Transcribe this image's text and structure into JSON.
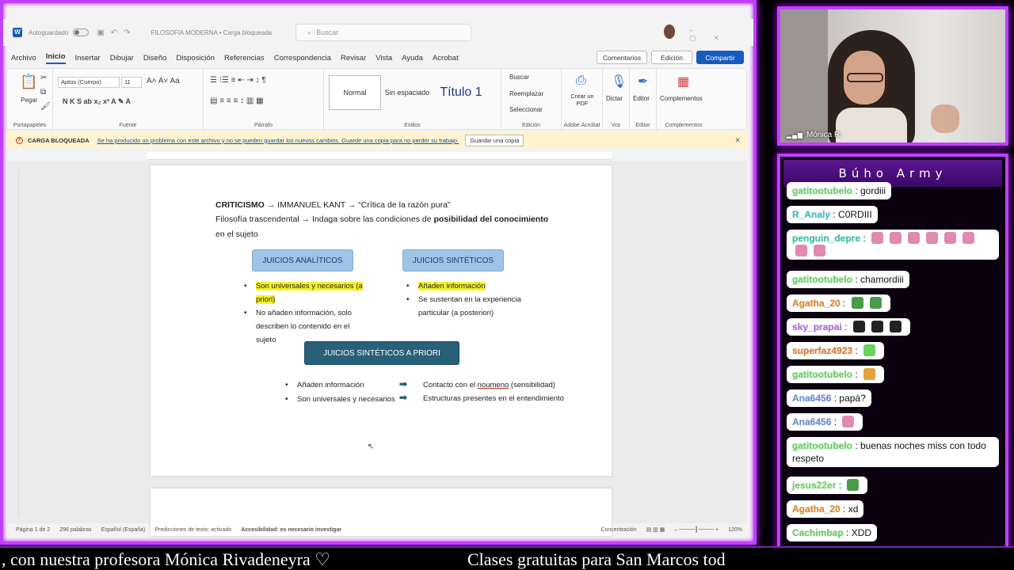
{
  "word": {
    "autosave_label": "Autoguardado",
    "doc_title": "FILOSOFIA MODERNA • Carga bloqueada",
    "search_placeholder": "Buscar",
    "menu": [
      "Archivo",
      "Inicio",
      "Insertar",
      "Dibujar",
      "Diseño",
      "Disposición",
      "Referencias",
      "Correspondencia",
      "Revisar",
      "Vista",
      "Ayuda",
      "Acrobat"
    ],
    "comments_label": "Comentarios",
    "edit_label": "Edición",
    "share_label": "Compartir",
    "ribbon": {
      "paste": "Pegar",
      "clipboard": "Portapapeles",
      "font_name": "Aptos (Cuerpo)",
      "font_size": "11",
      "font_group": "Fuente",
      "paragraph_group": "Párrafo",
      "styles": [
        "Normal",
        "Sin espaciado",
        "Título 1"
      ],
      "styles_group": "Estilos",
      "find": "Buscar",
      "replace": "Reemplazar",
      "select": "Seleccionar",
      "edit_group": "Edición",
      "create_pdf": "Crear un PDF",
      "acrobat_group": "Adobe Acrobat",
      "dictate": "Dictar",
      "voice_group": "Voz",
      "editor": "Editor",
      "editor_group": "Editor",
      "addins": "Complementos",
      "addins_group": "Complementos"
    },
    "notification": {
      "title": "CARGA BLOQUEADA",
      "message": "Se ha producido un problema con este archivo y no se pueden guardar los nuevos cambios. Guarde una copia para no perder su trabajo.",
      "button": "Guardar una copia"
    },
    "document": {
      "line1_bold": "CRITICISMO",
      "line1_rest": " → IMMANUEL KANT → “Crítica de la razón pura”",
      "line2_start": "Filosofía trascendental → Indaga sobre las condiciones de ",
      "line2_bold": "posibilidad del conocimiento",
      "line3": "en el sujeto",
      "box_analiticos": "JUICIOS ANALÍTICOS",
      "box_sinteticos": "JUICIOS SINTÉTICOS",
      "box_apriori": "JUICIOS SINTÉTICOS A PRIORI",
      "analiticos_b1": "Son universales y necesarios (a priori)",
      "analiticos_b2": "No añaden información, solo describen lo contenido en el sujeto",
      "sinteticos_b1": "Añaden información",
      "sinteticos_b2": "Se sustentan en la experiencia particular (a posteriori)",
      "apriori_b1": "Añaden información",
      "apriori_b2": "Son universales y necesarios",
      "apriori_r1_a": "Contacto con el ",
      "apriori_r1_b": "noumeno",
      "apriori_r1_c": " (sensibilidad)",
      "apriori_r2": "Estructuras presentes en el entendimiento"
    },
    "status": {
      "page": "Página 1 de 2",
      "words": "296 palabras",
      "language": "Español (España)",
      "predictions": "Predicciones de texto: activado",
      "accessibility": "Accesibilidad: es necesario investigar",
      "focus": "Concentración",
      "zoom": "120%"
    }
  },
  "webcam": {
    "name": "Mónica R."
  },
  "chat": {
    "title": "Búho Army",
    "messages": [
      {
        "user": "gatitootubelo",
        "text": "gordiii",
        "color": "#5fd45f"
      },
      {
        "user": "R_Analy",
        "text": "C0RDIII",
        "color": "#3cc3c3"
      },
      {
        "user": "penguin_depre",
        "text": "",
        "color": "#3cc3a0",
        "emotes": 8
      },
      {
        "user": "gatitootubelo",
        "text": "chamordiii",
        "color": "#5fd45f"
      },
      {
        "user": "Agatha_20",
        "text": "",
        "color": "#e08a2c",
        "emotes": 2
      },
      {
        "user": "sky_prapai",
        "text": "",
        "color": "#b06be0",
        "emotes": 3
      },
      {
        "user": "superfaz4923",
        "text": "",
        "color": "#e07a2c",
        "emotes": 1
      },
      {
        "user": "gatitootubelo",
        "text": "",
        "color": "#5fd45f",
        "emotes": 1
      },
      {
        "user": "Ana6456",
        "text": "papá?",
        "color": "#6b8fd8"
      },
      {
        "user": "Ana6456",
        "text": "",
        "color": "#6b8fd8",
        "emotes": 1
      },
      {
        "user": "gatitootubelo",
        "text": "buenas noches miss con todo respeto",
        "color": "#5fd45f"
      },
      {
        "user": "jesus22er",
        "text": "",
        "color": "#6ad45f",
        "emotes": 1
      },
      {
        "user": "Agatha_20",
        "text": "xd",
        "color": "#e08a2c"
      },
      {
        "user": "Cachimbap",
        "text": "XDD",
        "color": "#5fd45f"
      }
    ]
  },
  "ticker": {
    "left": ", con nuestra profesora Mónica Rivadeneyra  ♡",
    "right": "Clases gratuitas para San Marcos tod"
  },
  "colors": {
    "neon": "#c040ff",
    "word_blue": "#185abd",
    "highlight": "#f6f32b",
    "box_light": "#9fc4e8",
    "box_dark": "#28607a"
  }
}
